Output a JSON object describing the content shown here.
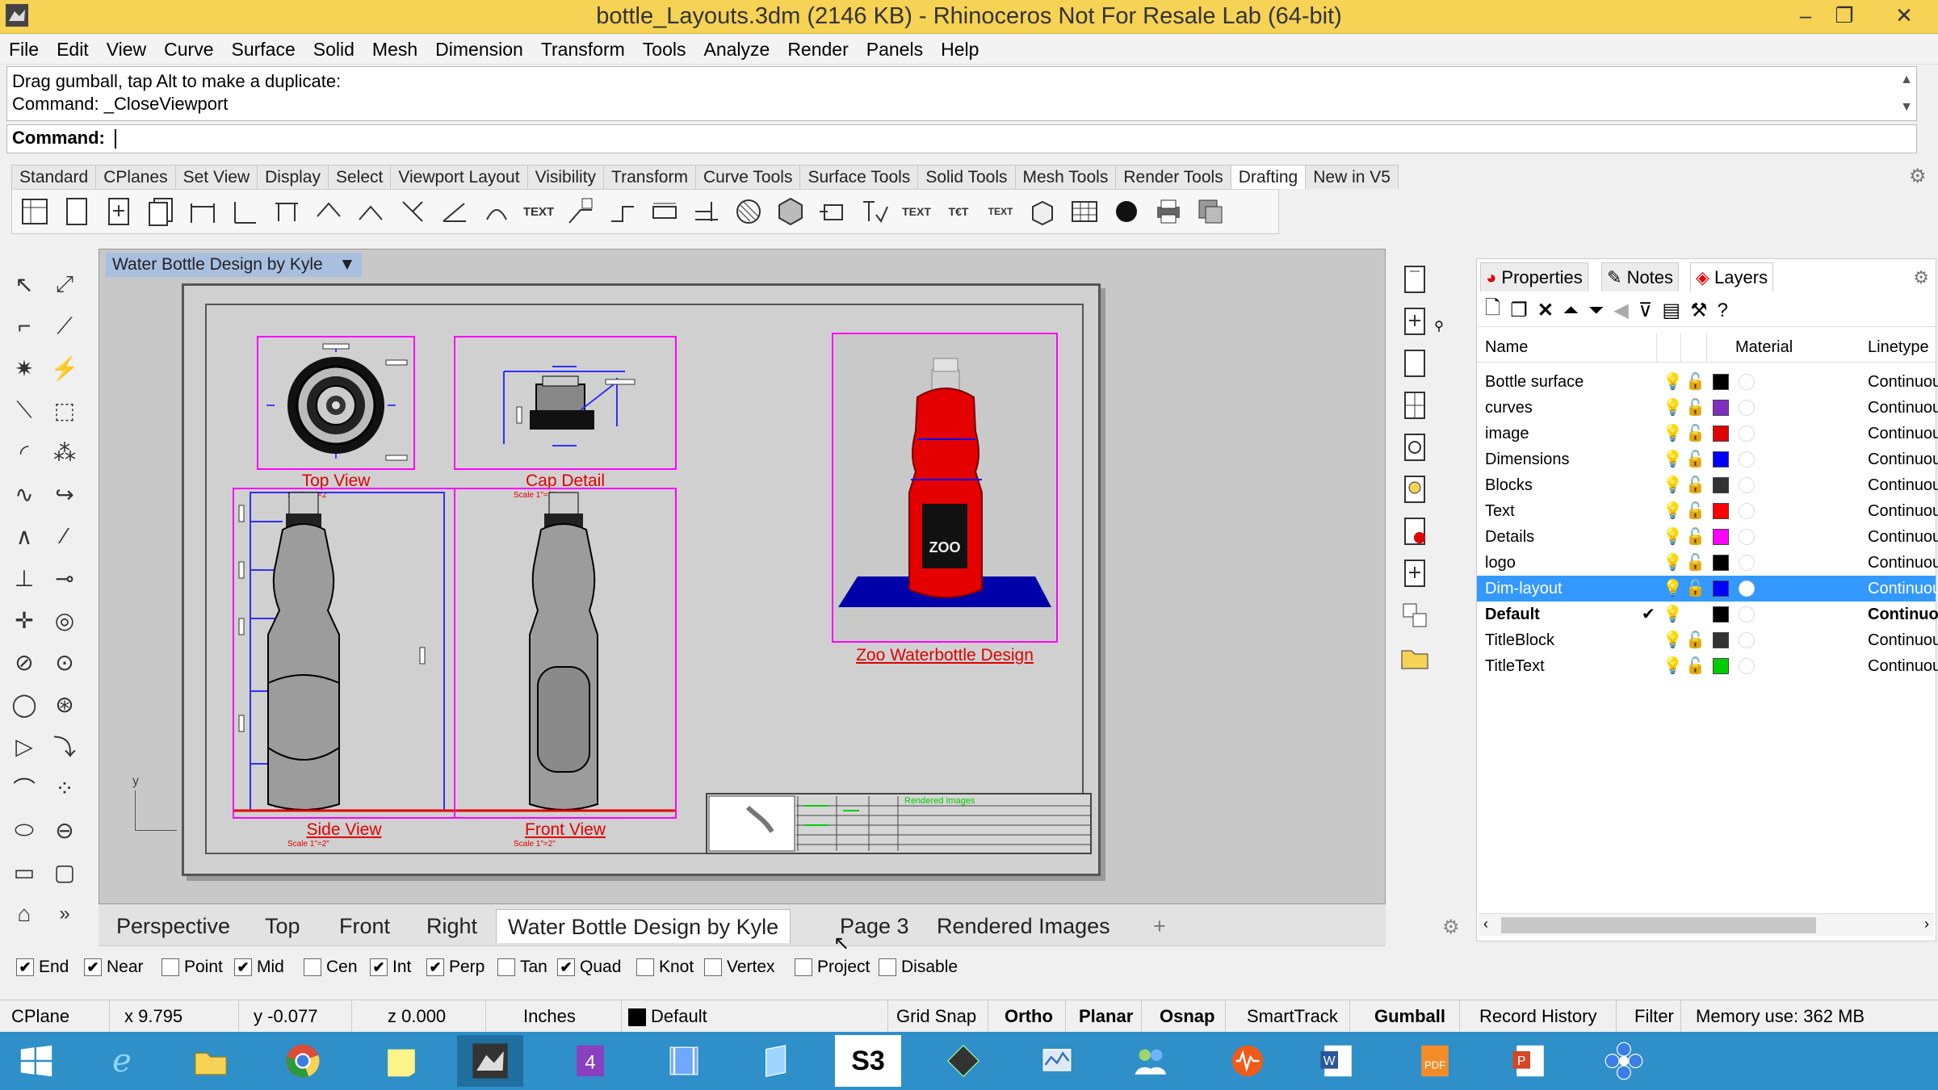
{
  "window": {
    "title": "bottle_Layouts.3dm (2146 KB) - Rhinoceros Not For Resale Lab (64-bit)"
  },
  "menu": [
    "File",
    "Edit",
    "View",
    "Curve",
    "Surface",
    "Solid",
    "Mesh",
    "Dimension",
    "Transform",
    "Tools",
    "Analyze",
    "Render",
    "Panels",
    "Help"
  ],
  "command": {
    "history_1": "Drag gumball, tap Alt to make a duplicate:",
    "history_2": "Command: _CloseViewport",
    "prompt": "Command:"
  },
  "toolbar_tabs": [
    "Standard",
    "CPlanes",
    "Set View",
    "Display",
    "Select",
    "Viewport Layout",
    "Visibility",
    "Transform",
    "Curve Tools",
    "Surface Tools",
    "Solid Tools",
    "Mesh Tools",
    "Render Tools",
    "Drafting",
    "New in V5"
  ],
  "active_toolbar_tab": "Drafting",
  "viewport": {
    "title": "Water Bottle Design by Kyle",
    "details": {
      "top_view": "Top View",
      "cap_detail": "Cap Detail",
      "side_view": "Side View",
      "front_view": "Front View",
      "render_caption": "Zoo Waterbottle Design",
      "scale_note": "Scale 1\"=2\"",
      "titleblock_text": "Rendered Images"
    },
    "axis_label": "y"
  },
  "view_tabs": [
    "Perspective",
    "Top",
    "Front",
    "Right",
    "Water Bottle Design by Kyle",
    "Page 3",
    "Rendered Images"
  ],
  "active_view_tab": "Water Bottle Design by Kyle",
  "osnaps": [
    {
      "label": "End",
      "checked": true
    },
    {
      "label": "Near",
      "checked": true
    },
    {
      "label": "Point",
      "checked": false
    },
    {
      "label": "Mid",
      "checked": true
    },
    {
      "label": "Cen",
      "checked": false
    },
    {
      "label": "Int",
      "checked": true
    },
    {
      "label": "Perp",
      "checked": true
    },
    {
      "label": "Tan",
      "checked": false
    },
    {
      "label": "Quad",
      "checked": true
    },
    {
      "label": "Knot",
      "checked": false
    },
    {
      "label": "Vertex",
      "checked": false
    },
    {
      "label": "Project",
      "checked": false
    },
    {
      "label": "Disable",
      "checked": false
    }
  ],
  "status": {
    "cplane": "CPlane",
    "x": "x 9.795",
    "y": "y -0.077",
    "z": "z 0.000",
    "units": "Inches",
    "layer": "Default",
    "grid_snap": "Grid Snap",
    "ortho": "Ortho",
    "planar": "Planar",
    "osnap": "Osnap",
    "smarttrack": "SmartTrack",
    "gumball": "Gumball",
    "record_history": "Record History",
    "filter": "Filter",
    "memory": "Memory use: 362 MB"
  },
  "panel": {
    "tabs": [
      "Properties",
      "Notes",
      "Layers"
    ],
    "active_tab": "Layers",
    "columns": {
      "name": "Name",
      "material": "Material",
      "linetype": "Linetype"
    },
    "layers": [
      {
        "name": "Bottle surface",
        "color": "#000000",
        "linetype": "Continuou"
      },
      {
        "name": "curves",
        "color": "#7f2fbf",
        "linetype": "Continuou"
      },
      {
        "name": "image",
        "color": "#e00000",
        "linetype": "Continuou"
      },
      {
        "name": "Dimensions",
        "color": "#0000ff",
        "linetype": "Continuou"
      },
      {
        "name": "Blocks",
        "color": "#333333",
        "linetype": "Continuou"
      },
      {
        "name": "Text",
        "color": "#ff0000",
        "linetype": "Continuou"
      },
      {
        "name": "Details",
        "color": "#ff00ff",
        "linetype": "Continuou"
      },
      {
        "name": "logo",
        "color": "#000000",
        "linetype": "Continuou"
      },
      {
        "name": "Dim-layout",
        "color": "#0000ff",
        "linetype": "Continuou"
      },
      {
        "name": "Default",
        "color": "#000000",
        "linetype": "Continuou"
      },
      {
        "name": "TitleBlock",
        "color": "#333333",
        "linetype": "Continuou"
      },
      {
        "name": "TitleText",
        "color": "#00cc00",
        "linetype": "Continuou"
      }
    ],
    "selected_layer": "Dim-layout",
    "current_layer": "Default"
  },
  "colors": {
    "titlebar": "#f6d255",
    "selection": "#3399ff",
    "detail_border": "#ff00ff",
    "caption_red": "#e00000",
    "taskbar": "#2f8fc8"
  }
}
